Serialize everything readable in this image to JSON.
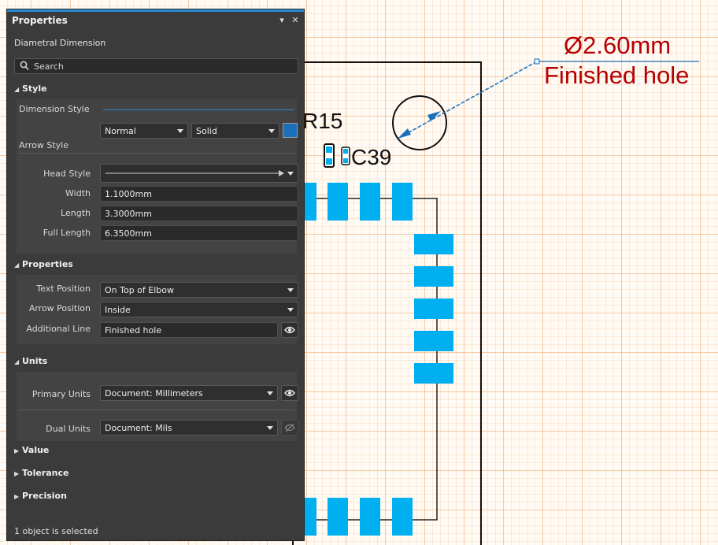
{
  "panel": {
    "title": "Properties",
    "pin_glyph": "▾",
    "close_glyph": "✕",
    "object_type": "Diametral Dimension",
    "search_placeholder": "Search",
    "status": "1 object is selected"
  },
  "style_section": {
    "title": "Style",
    "dimension_style_label": "Dimension Style",
    "arrow_style_label": "Arrow Style",
    "arrow_mode": "Normal",
    "line_style": "Solid",
    "color": "#1a6fb8",
    "head_style_label": "Head Style",
    "width_label": "Width",
    "width_value": "1.1000mm",
    "length_label": "Length",
    "length_value": "3.3000mm",
    "full_length_label": "Full Length",
    "full_length_value": "6.3500mm"
  },
  "properties_section": {
    "title": "Properties",
    "text_position_label": "Text Position",
    "text_position_value": "On Top of Elbow",
    "arrow_position_label": "Arrow Position",
    "arrow_position_value": "Inside",
    "additional_line_label": "Additional Line",
    "additional_line_value": "Finished hole"
  },
  "units_section": {
    "title": "Units",
    "primary_units_label": "Primary Units",
    "primary_units_value": "Document: Millimeters",
    "dual_units_label": "Dual Units",
    "dual_units_value": "Document: Mils"
  },
  "collapsed_sections": {
    "value": "Value",
    "tolerance": "Tolerance",
    "precision": "Precision"
  },
  "canvas": {
    "dimension_text": "Ø2.60mm",
    "additional_line_text": "Finished hole",
    "label_r15": "R15",
    "label_c39": "C39",
    "colors": {
      "pad": "#00aff0",
      "dimension": "#1a6fb8",
      "dimension_text": "#b50000",
      "outline": "#111111",
      "grid": "#ee9650"
    }
  }
}
